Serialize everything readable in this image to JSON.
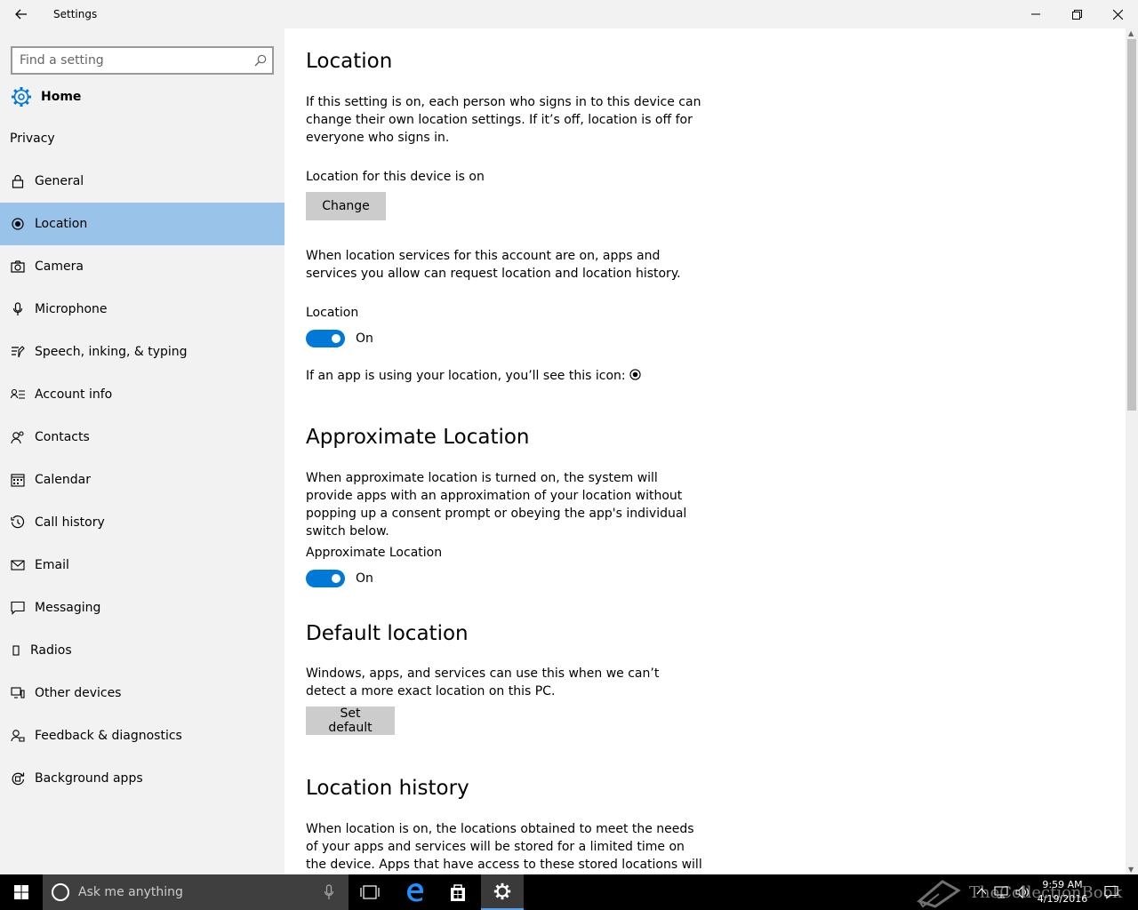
{
  "window": {
    "title": "Settings",
    "back_icon": "back-arrow-icon",
    "controls": [
      "minimize-icon",
      "restore-icon",
      "close-icon"
    ]
  },
  "sidebar": {
    "search_placeholder": "Find a setting",
    "home_label": "Home",
    "section_label": "Privacy",
    "items": [
      {
        "label": "General",
        "icon": "lock-icon",
        "active": false
      },
      {
        "label": "Location",
        "icon": "location-icon",
        "active": true
      },
      {
        "label": "Camera",
        "icon": "camera-icon",
        "active": false
      },
      {
        "label": "Microphone",
        "icon": "microphone-icon",
        "active": false
      },
      {
        "label": "Speech, inking, & typing",
        "icon": "speech-icon",
        "active": false
      },
      {
        "label": "Account info",
        "icon": "account-info-icon",
        "active": false
      },
      {
        "label": "Contacts",
        "icon": "contacts-icon",
        "active": false
      },
      {
        "label": "Calendar",
        "icon": "calendar-icon",
        "active": false
      },
      {
        "label": "Call history",
        "icon": "call-history-icon",
        "active": false
      },
      {
        "label": "Email",
        "icon": "email-icon",
        "active": false
      },
      {
        "label": "Messaging",
        "icon": "messaging-icon",
        "active": false
      },
      {
        "label": "Radios",
        "icon": "radios-icon",
        "active": false
      },
      {
        "label": "Other devices",
        "icon": "other-devices-icon",
        "active": false
      },
      {
        "label": "Feedback & diagnostics",
        "icon": "feedback-icon",
        "active": false
      },
      {
        "label": "Background apps",
        "icon": "background-apps-icon",
        "active": false
      }
    ]
  },
  "main": {
    "location": {
      "title": "Location",
      "intro": "If this setting is on, each person who signs in to this device can change their own location settings. If it’s off, location is off for everyone who signs in.",
      "device_status": "Location for this device is on",
      "change_button": "Change",
      "services_desc": "When location services for this account are on, apps and services you allow can request location and location history.",
      "toggle_label": "Location",
      "toggle_state": "On",
      "icon_note": "If an app is using your location, you’ll see this icon:"
    },
    "approximate": {
      "title": "Approximate Location",
      "desc": "When approximate location is turned on, the system will provide apps with an approximation of your location without popping up a consent prompt or obeying the app's individual switch below.",
      "toggle_label": "Approximate Location",
      "toggle_state": "On"
    },
    "default_location": {
      "title": "Default location",
      "desc": "Windows, apps, and services can use this when we can’t detect a more exact location on this PC.",
      "button": "Set default"
    },
    "history": {
      "title": "Location history",
      "desc": "When location is on, the locations obtained to meet the needs of your apps and services will be stored for a limited time on the device. Apps that have access to these stored locations will appear"
    }
  },
  "taskbar": {
    "search_text": "Ask me anything",
    "watermark": "TheCollectionBook",
    "time": "9:59 AM",
    "date": "4/19/2016"
  },
  "colors": {
    "accent": "#0078d7",
    "sidebar_bg": "#f2f2f2",
    "selected_bg": "#99c3e8",
    "taskbar_bg": "#000000"
  }
}
